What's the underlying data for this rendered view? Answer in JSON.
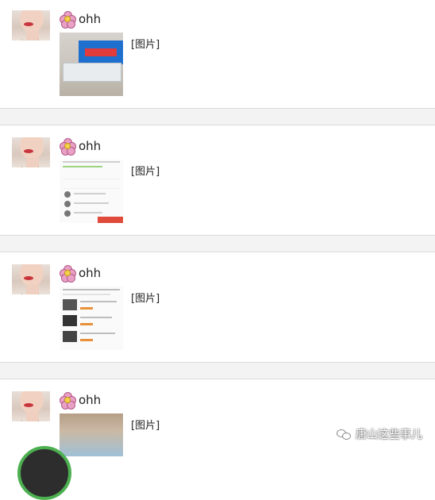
{
  "posts": [
    {
      "username": "ohh",
      "image_label": "[图片]"
    },
    {
      "username": "ohh",
      "image_label": "[图片]"
    },
    {
      "username": "ohh",
      "image_label": "[图片]"
    },
    {
      "username": "ohh",
      "image_label": "[图片]"
    }
  ],
  "watermark": {
    "text": "唐山这些事儿"
  },
  "colors": {
    "separator": "#f3f3f3",
    "flower": "#e8a1c4",
    "accent_red": "#e04a3a"
  }
}
